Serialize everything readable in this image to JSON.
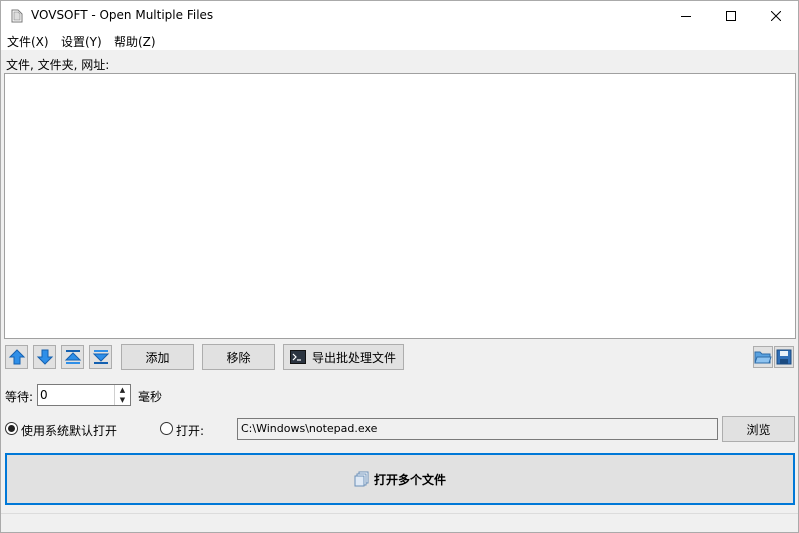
{
  "window": {
    "title": "VOVSOFT - Open Multiple Files",
    "controls": [
      "minimize-icon",
      "maximize-icon",
      "close-icon"
    ]
  },
  "menu": {
    "items": [
      {
        "label": "文件(X)"
      },
      {
        "label": "设置(Y)"
      },
      {
        "label": "帮助(Z)"
      }
    ]
  },
  "files": {
    "label": "文件, 文件夹, 网址:",
    "items": []
  },
  "toolbar": {
    "move_up_icon": "arrow-up-icon",
    "move_down_icon": "arrow-down-icon",
    "move_top_icon": "arrow-top-icon",
    "move_bottom_icon": "arrow-bottom-icon",
    "add_label": "添加",
    "remove_label": "移除",
    "export_label": "导出批处理文件",
    "open_folder_icon": "folder-open-icon",
    "save_icon": "save-icon"
  },
  "wait": {
    "label": "等待:",
    "value": "0",
    "unit": "毫秒"
  },
  "open_mode": {
    "default_label": "使用系统默认打开",
    "default_checked": true,
    "open_with_label": "打开:",
    "open_with_checked": false,
    "program_path": "C:\\Windows\\notepad.exe",
    "browse_label": "浏览"
  },
  "main_action": {
    "label": "打开多个文件",
    "icon": "files-icon"
  },
  "colors": {
    "accent": "#0078d7",
    "arrow_blue": "#2f8fe8"
  }
}
